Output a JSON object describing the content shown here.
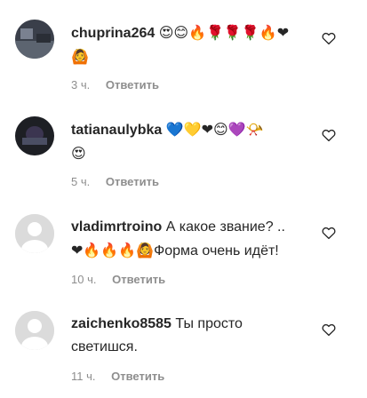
{
  "comments": [
    {
      "username": "chuprina264",
      "text": "",
      "emoji": "😍😊🔥🌹🌹🌹🔥❤",
      "emoji2": "🙆",
      "time": "3 ч.",
      "reply": "Ответить",
      "avatar": "photo-dark"
    },
    {
      "username": "tatianaulybka",
      "text": "",
      "emoji": "💙💛❤😊💜📯",
      "emoji2": "😍",
      "time": "5 ч.",
      "reply": "Ответить",
      "avatar": "photo-dark"
    },
    {
      "username": "vladimrtroino",
      "text": "А какое звание? ..",
      "text2": "Форма очень идёт!",
      "emoji2": "❤🔥🔥🔥🙆",
      "time": "10 ч.",
      "reply": "Ответить",
      "avatar": "default"
    },
    {
      "username": "zaichenko8585",
      "text": "Ты просто",
      "text2": "светишся.",
      "time": "11 ч.",
      "reply": "Ответить",
      "avatar": "default"
    }
  ],
  "icons": {
    "like": "heart-outline-icon",
    "avatar": "avatar-placeholder-icon"
  },
  "colors": {
    "meta": "#8e8e8e",
    "text": "#262626",
    "avatar_bg": "#dbdbdb"
  }
}
